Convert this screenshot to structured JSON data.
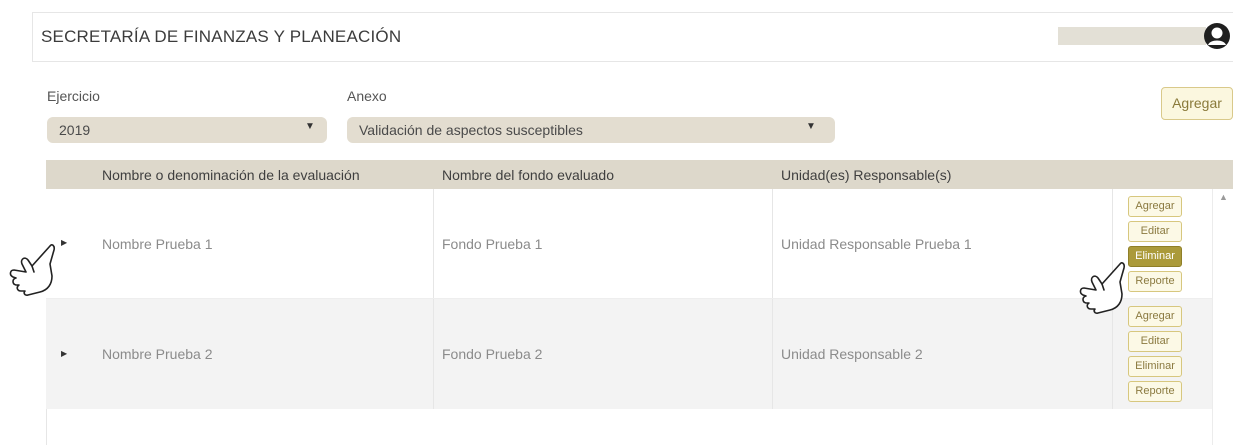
{
  "header": {
    "title": "SECRETARÍA DE FINANZAS Y PLANEACIÓN"
  },
  "filters": {
    "ejercicio_label": "Ejercicio",
    "ejercicio_value": "2019",
    "anexo_label": "Anexo",
    "anexo_value": "Validación de aspectos susceptibles",
    "add_button": "Agregar"
  },
  "table": {
    "columns": [
      "Nombre o denominación de la evaluación",
      "Nombre del fondo evaluado",
      "Unidad(es) Responsable(s)"
    ],
    "rows": [
      {
        "nombre": "Nombre Prueba 1",
        "fondo": "Fondo Prueba 1",
        "unidad": "Unidad Responsable Prueba 1",
        "actions": [
          "Agregar",
          "Editar",
          "Eliminar",
          "Reporte"
        ]
      },
      {
        "nombre": "Nombre Prueba 2",
        "fondo": "Fondo Prueba 2",
        "unidad": "Unidad Responsable 2",
        "actions": [
          "Agregar",
          "Editar",
          "Eliminar",
          "Reporte"
        ]
      }
    ],
    "active_action": "Eliminar"
  },
  "icons": {
    "avatar": "user-avatar-icon",
    "expander": "caret-right-icon",
    "pointer": "hand-pointer-icon"
  },
  "colors": {
    "accent": "#ab9a3a",
    "button_bg": "#fcf9e6",
    "header_row": "#ddd8cb",
    "select_bg": "#e3ddd0"
  }
}
